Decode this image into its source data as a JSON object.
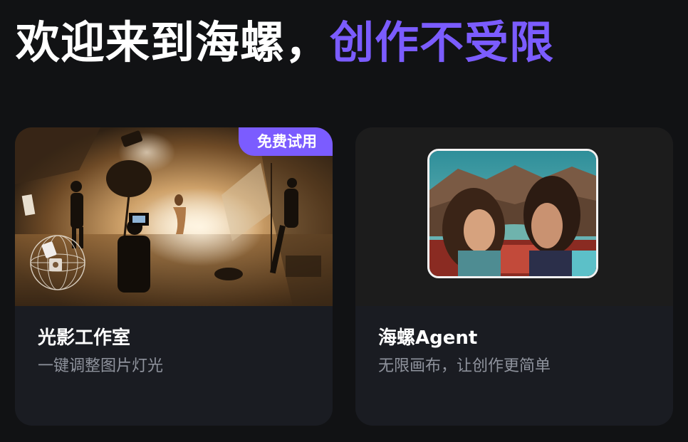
{
  "header": {
    "title_part1": "欢迎来到海螺，",
    "title_part2": "创作不受限"
  },
  "cards": [
    {
      "title": "光影工作室",
      "description": "一键调整图片灯光",
      "badge": "免费试用"
    },
    {
      "title": "海螺Agent",
      "description": "无限画布，让创作更简单"
    }
  ],
  "colors": {
    "background": "#111214",
    "card_background": "#1a1c22",
    "accent": "#7b5cff",
    "title": "#ffffff",
    "description": "#8f939d"
  }
}
